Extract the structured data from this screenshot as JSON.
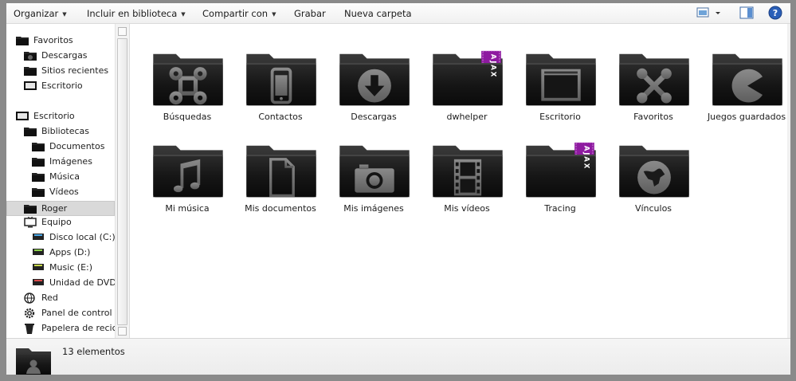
{
  "toolbar": {
    "organize": "Organizar",
    "include_library": "Incluir en biblioteca",
    "share_with": "Compartir con",
    "burn": "Grabar",
    "new_folder": "Nueva carpeta",
    "view_icon": "view-options-icon",
    "preview_icon": "preview-pane-icon",
    "help_icon": "help-icon"
  },
  "nav": {
    "favorites": "Favoritos",
    "downloads": "Descargas",
    "recent_places": "Sitios recientes",
    "desktop_fav": "Escritorio",
    "desktop": "Escritorio",
    "libraries": "Bibliotecas",
    "documents": "Documentos",
    "images": "Imágenes",
    "music": "Música",
    "videos": "Vídeos",
    "user": "Roger",
    "computer": "Equipo",
    "disk_c": "Disco local (C:)",
    "disk_d": "Apps (D:)",
    "disk_e": "Music (E:)",
    "dvd": "Unidad de DVD",
    "network": "Red",
    "control_panel": "Panel de control",
    "recycle_bin": "Papelera de recicla"
  },
  "folders": [
    {
      "label": "Búsquedas",
      "icon": "command-key-icon"
    },
    {
      "label": "Contactos",
      "icon": "phone-icon"
    },
    {
      "label": "Descargas",
      "icon": "download-arrow-icon"
    },
    {
      "label": "dwhelper",
      "icon": "ajax-ribbon-icon",
      "ribbon": "AJAX"
    },
    {
      "label": "Escritorio",
      "icon": "desktop-window-icon"
    },
    {
      "label": "Favoritos",
      "icon": "joomla-icon"
    },
    {
      "label": "Juegos guardados",
      "icon": "pacman-icon"
    },
    {
      "label": "Mi música",
      "icon": "music-note-icon"
    },
    {
      "label": "Mis documentos",
      "icon": "document-icon"
    },
    {
      "label": "Mis imágenes",
      "icon": "camera-icon"
    },
    {
      "label": "Mis vídeos",
      "icon": "film-icon"
    },
    {
      "label": "Tracing",
      "icon": "ajax-ribbon-icon",
      "ribbon": "AJAX"
    },
    {
      "label": "Vínculos",
      "icon": "globe-icon"
    }
  ],
  "status": {
    "count": "13 elementos"
  },
  "colors": {
    "ribbon": "#8e1aa0",
    "selected": "#d9d9d9",
    "folder": "#151515"
  }
}
